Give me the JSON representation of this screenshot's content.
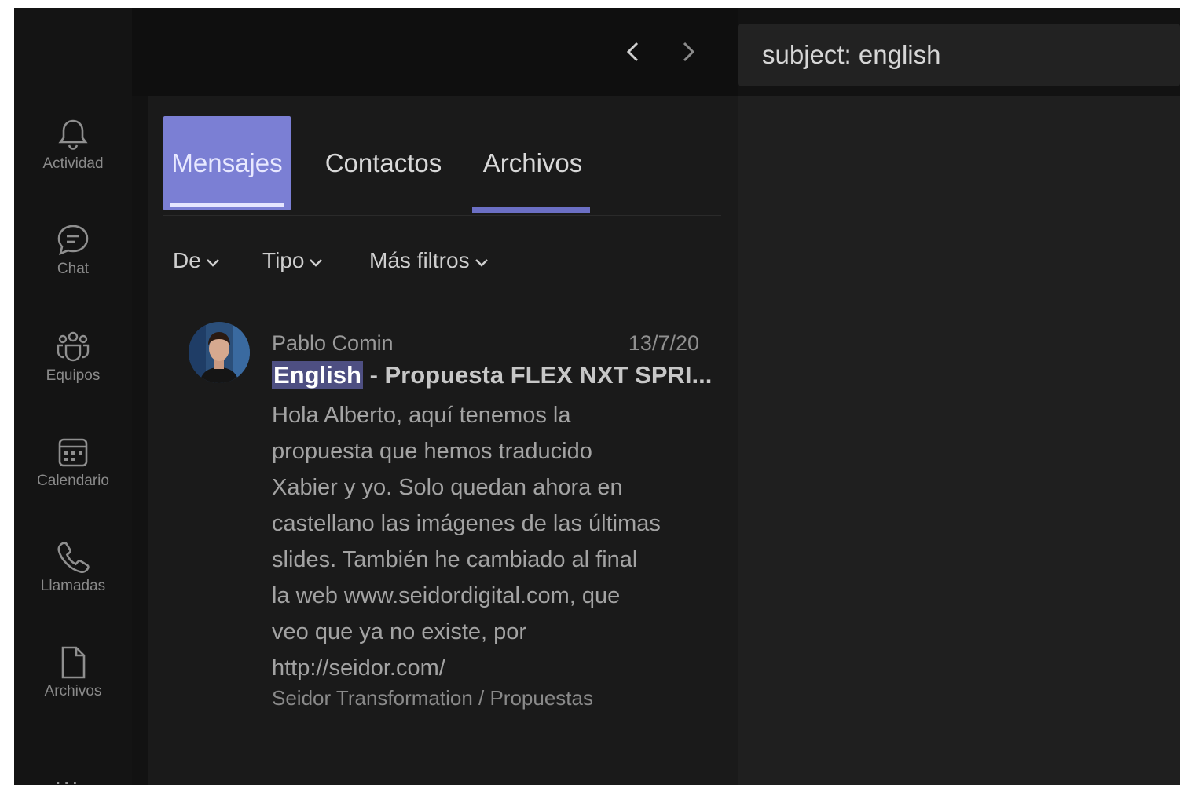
{
  "window": {
    "traffic_lights": [
      "close",
      "minimize",
      "zoom"
    ]
  },
  "nav": {
    "back_icon": "chevron-left-icon",
    "forward_icon": "chevron-right-icon"
  },
  "search": {
    "value": "subject: english"
  },
  "sidebar": {
    "items": [
      {
        "label": "Actividad",
        "icon": "bell-icon"
      },
      {
        "label": "Chat",
        "icon": "chat-icon"
      },
      {
        "label": "Equipos",
        "icon": "teams-icon"
      },
      {
        "label": "Calendario",
        "icon": "calendar-icon"
      },
      {
        "label": "Llamadas",
        "icon": "phone-icon"
      },
      {
        "label": "Archivos",
        "icon": "file-icon"
      }
    ],
    "more": "..."
  },
  "tabs": [
    {
      "label": "Mensajes",
      "selected": true
    },
    {
      "label": "Contactos",
      "selected": false
    },
    {
      "label": "Archivos",
      "selected": false
    }
  ],
  "filters": [
    {
      "label": "De"
    },
    {
      "label": "Tipo"
    },
    {
      "label": "Más filtros"
    }
  ],
  "result": {
    "sender": "Pablo Comin",
    "date": "13/7/20",
    "subject_highlight": "English",
    "subject_rest": " - Propuesta FLEX NXT SPRI...",
    "body_lines": [
      "Hola Alberto, aquí tenemos la",
      "propuesta que hemos traducido",
      "Xabier y yo. Solo quedan ahora en",
      "castellano las imágenes de las últimas",
      "slides. También he cambiado al final",
      "la web www.seidordigital.com, que",
      "veo que ya no existe, por",
      "http://seidor.com/"
    ],
    "channel": "Seidor Transformation / Propuestas"
  },
  "colors": {
    "accent": "#7b7fd4",
    "highlight": "#4e4f82",
    "background": "#121212"
  }
}
